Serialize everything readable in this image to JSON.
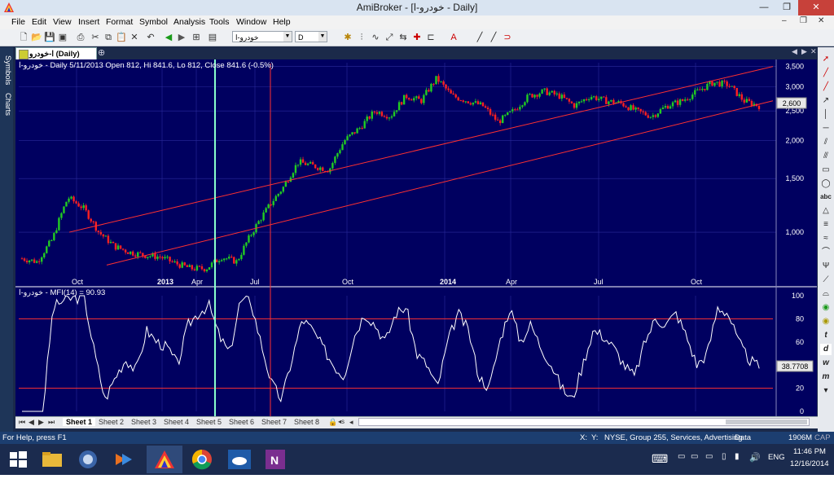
{
  "window": {
    "title": "AmiBroker - [خودرو-ا - Daily]",
    "controls": {
      "minimize": "—",
      "restore": "❐",
      "close": "✕"
    }
  },
  "menu": [
    "File",
    "Edit",
    "View",
    "Insert",
    "Format",
    "Symbol",
    "Analysis",
    "Tools",
    "Window",
    "Help"
  ],
  "toolbar": {
    "symbol_value": "خودرو-ا",
    "interval_value": "D"
  },
  "side_tabs": [
    "Symbols",
    "Charts"
  ],
  "chart_tab": {
    "label": "ا-خودرو (Daily)"
  },
  "colors": {
    "chart_bg": "#000060",
    "price_up": "#22cc22",
    "price_down": "#ff2020",
    "channel": "#ff3030",
    "mfi_line": "#ffffff",
    "grid": "#2a2a9a",
    "cursor_green": "#88ffcc",
    "cursor_red": "#ff3030"
  },
  "price_pane": {
    "header": "خودرو-ا - Daily 5/11/2013 Open 812, Hi 841.6, Lo 812, Close 841.6 (-0.5%)",
    "y_ticks": [
      "3,500",
      "3,000",
      "2,500",
      "2,000",
      "1,500",
      "1,000"
    ],
    "last_price_label": "2,600",
    "x_ticks": [
      "Oct",
      "2013",
      "Apr",
      "Jul",
      "Oct",
      "2014",
      "Apr",
      "Jul",
      "Oct"
    ]
  },
  "mfi_pane": {
    "header": "خودرو-ا - MFI(14) = 90.93",
    "y_ticks": [
      "100",
      "80",
      "60",
      "40",
      "20",
      "0"
    ],
    "last_value_label": "38.7708"
  },
  "chart_data": [
    {
      "type": "candlestick",
      "title": "",
      "scale": "log",
      "ylim": [
        700,
        3600
      ],
      "x": [
        "Oct",
        "2013",
        "Apr",
        "Jul",
        "Oct",
        "2014",
        "Apr",
        "Jul",
        "Oct"
      ],
      "close_path": [
        820,
        800,
        950,
        1300,
        1200,
        1000,
        900,
        860,
        840,
        830,
        790,
        760,
        760,
        830,
        800,
        1000,
        1200,
        1400,
        1700,
        1650,
        1600,
        2000,
        2200,
        2500,
        2400,
        2800,
        2700,
        3200,
        2800,
        2700,
        2600,
        2300,
        2500,
        2800,
        2900,
        2800,
        2600,
        2800,
        2700,
        2650,
        2500,
        2400,
        2600,
        2700,
        2900,
        3100,
        3050,
        2700,
        2600
      ],
      "channel_lines": 2
    },
    {
      "type": "line",
      "title": "",
      "name": "MFI(14)",
      "ylim": [
        0,
        100
      ],
      "reference_lines": [
        80,
        20
      ],
      "values": [
        0,
        0,
        0,
        90,
        96,
        98,
        98,
        50,
        10,
        30,
        45,
        35,
        70,
        60,
        55,
        40,
        75,
        85,
        92,
        65,
        50,
        95,
        96,
        60,
        25,
        10,
        45,
        80,
        70,
        55,
        40,
        30,
        65,
        85,
        75,
        60,
        85,
        90,
        50,
        40,
        20,
        60,
        85,
        70,
        30,
        20,
        60,
        90,
        60,
        75,
        55,
        40,
        20,
        10,
        40,
        70,
        65,
        55,
        40,
        30,
        60,
        80,
        75,
        85,
        65,
        40,
        50,
        90,
        85,
        60,
        45,
        38
      ]
    }
  ],
  "sheets": [
    "Sheet 1",
    "Sheet 2",
    "Sheet 3",
    "Sheet 4",
    "Sheet 5",
    "Sheet 6",
    "Sheet 7",
    "Sheet 8"
  ],
  "status": {
    "help": "For Help, press F1",
    "x": "X:",
    "y": "Y:",
    "info": "NYSE, Group 255, Services, Advertising",
    "data": "Data",
    "memory": "1906M",
    "cap": "CAP"
  },
  "taskbar": {
    "lang": "ENG",
    "time": "11:46 PM",
    "date": "12/16/2014"
  }
}
